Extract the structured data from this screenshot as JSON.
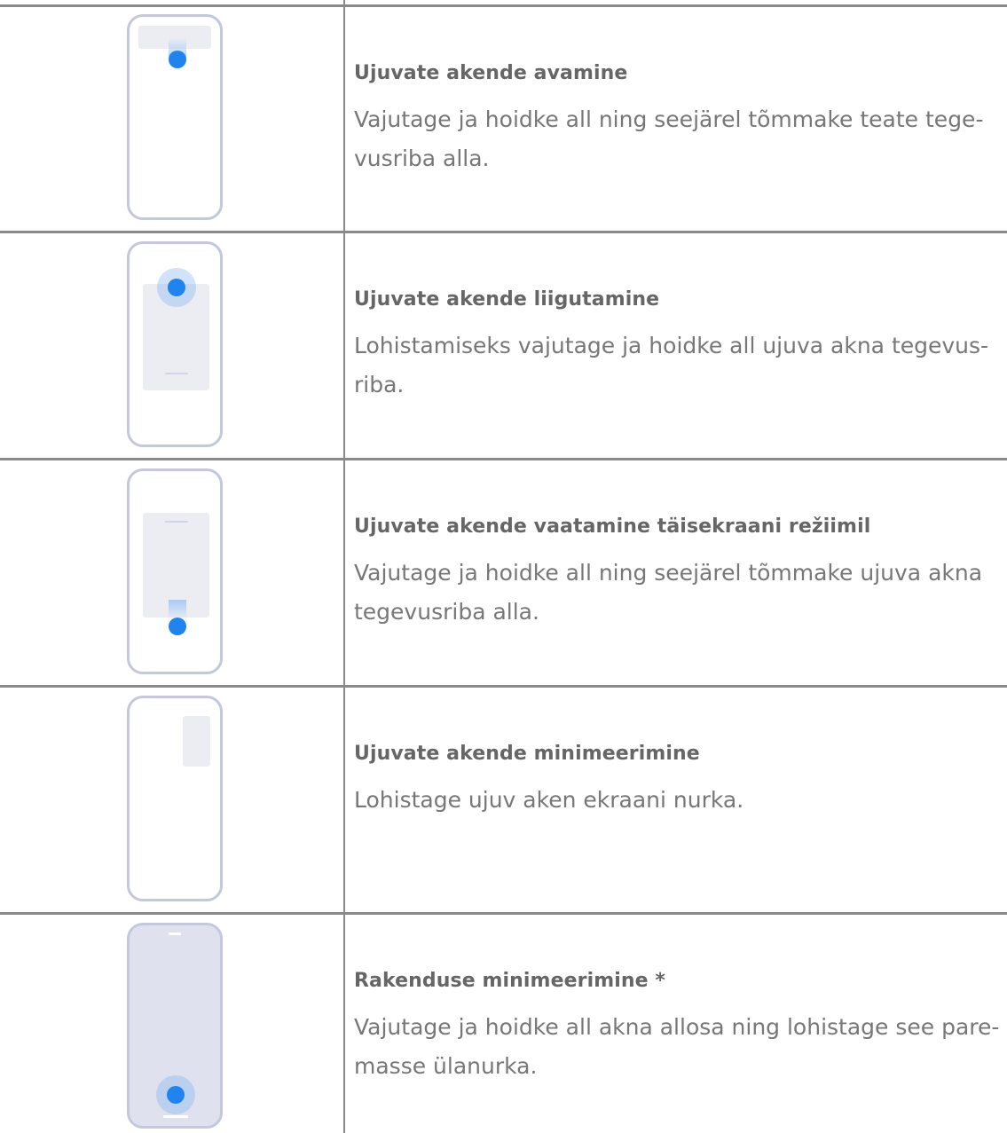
{
  "rows": [
    {
      "title": "Ujuvate akende avamine",
      "desc": "Vajutage ja hoidke all ning seejärel tõmmake teate tege-vusriba alla."
    },
    {
      "title": "Ujuvate akende liigutamine",
      "desc": "Lohistamiseks vajutage ja hoidke all ujuva akna tegevus-riba."
    },
    {
      "title": "Ujuvate akende vaatamine täisekraani režiimil",
      "desc": "Vajutage ja hoidke all ning seejärel tõmmake ujuva akna tegevusriba alla."
    },
    {
      "title": "Ujuvate akende minimeerimine",
      "desc": "Lohistage ujuv aken ekraani nurka."
    },
    {
      "title": "Rakenduse minimeerimine *",
      "desc": "Vajutage ja hoidke all akna allosa ning lohistage see pare-masse ülanurka."
    }
  ],
  "colors": {
    "accent": "#1f84f0",
    "phone_outline": "#c3c8de",
    "rule": "#8a8a8a"
  },
  "icons": [
    "phone-drag-notification-icon",
    "phone-move-window-icon",
    "phone-fullscreen-window-icon",
    "phone-minimize-window-icon",
    "phone-minimize-app-icon"
  ]
}
